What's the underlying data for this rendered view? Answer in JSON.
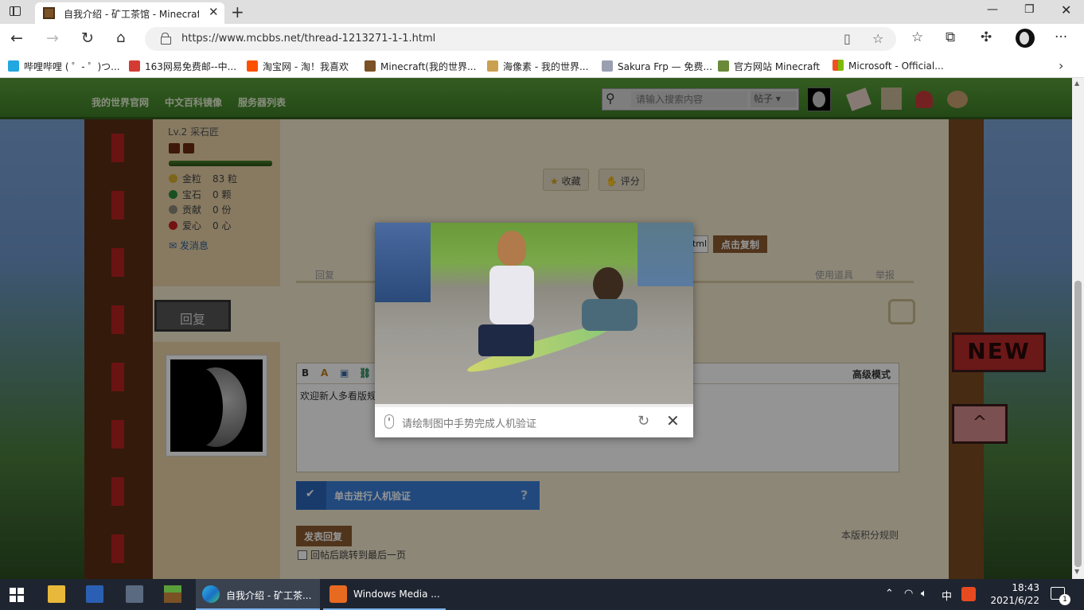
{
  "browser": {
    "tab_title": "自我介绍 - 矿工茶馆 - Minecraft(我的世界)中文论坛",
    "url": "https://www.mcbbs.net/thread-1213271-1-1.html",
    "bookmarks": [
      {
        "label": "哔哩哔哩 ( ゜- ゜)つ...",
        "color": "#22a7e0"
      },
      {
        "label": "163网易免费邮--中...",
        "color": "#d43c33"
      },
      {
        "label": "淘宝网 - 淘！我喜欢",
        "color": "#ff5000"
      },
      {
        "label": "Minecraft(我的世界...",
        "color": "#7a5226"
      },
      {
        "label": "海像素 - 我的世界...",
        "color": "#c8a050"
      },
      {
        "label": "Sakura Frp — 免费...",
        "color": "#9aa0b0"
      },
      {
        "label": "官方网站  Minecraft",
        "color": "#6a8a3a"
      },
      {
        "label": "Microsoft - Official...",
        "color": "#f25022"
      }
    ]
  },
  "site_nav": {
    "links": [
      "我的世界官网",
      "中文百科镜像",
      "服务器列表"
    ],
    "search_placeholder": "请输入搜索内容",
    "search_scope": "帖子"
  },
  "poster": {
    "level": "Lv.2 采石匠",
    "level_progress": 1.0,
    "stats": [
      {
        "label": "金粒",
        "value": "83 粒",
        "color": "#d8b030"
      },
      {
        "label": "宝石",
        "value": "0 颗",
        "color": "#2a8a3a"
      },
      {
        "label": "贡献",
        "value": "0 份",
        "color": "#8a8a7a"
      },
      {
        "label": "爱心",
        "value": "0 心",
        "color": "#c82020"
      }
    ],
    "send_message": "发消息"
  },
  "post": {
    "favorite": "收藏",
    "rate": "评分",
    "copy_html": "html",
    "copy_link": "点击复制",
    "reply": "回复",
    "use_tool": "使用道具",
    "report": "举报"
  },
  "reply_box": {
    "section_title": "回复",
    "advanced_mode": "高级模式",
    "editor_text": "欢迎新人多看版规",
    "verify_label": "单击进行人机验证",
    "verify_help": "?",
    "submit": "发表回复",
    "rules": "本版积分规则",
    "jump_last": "回帖后跳转到最后一页"
  },
  "side_signs": {
    "new": "NEW",
    "top": "^"
  },
  "captcha": {
    "instruction": "请绘制图中手势完成人机验证"
  },
  "taskbar": {
    "items": [
      {
        "label": "自我介绍 - 矿工茶...",
        "active": true
      },
      {
        "label": "Windows Media ...",
        "active": false
      }
    ],
    "ime": "中",
    "time": "18:43",
    "date": "2021/6/22",
    "notifications": "1"
  }
}
